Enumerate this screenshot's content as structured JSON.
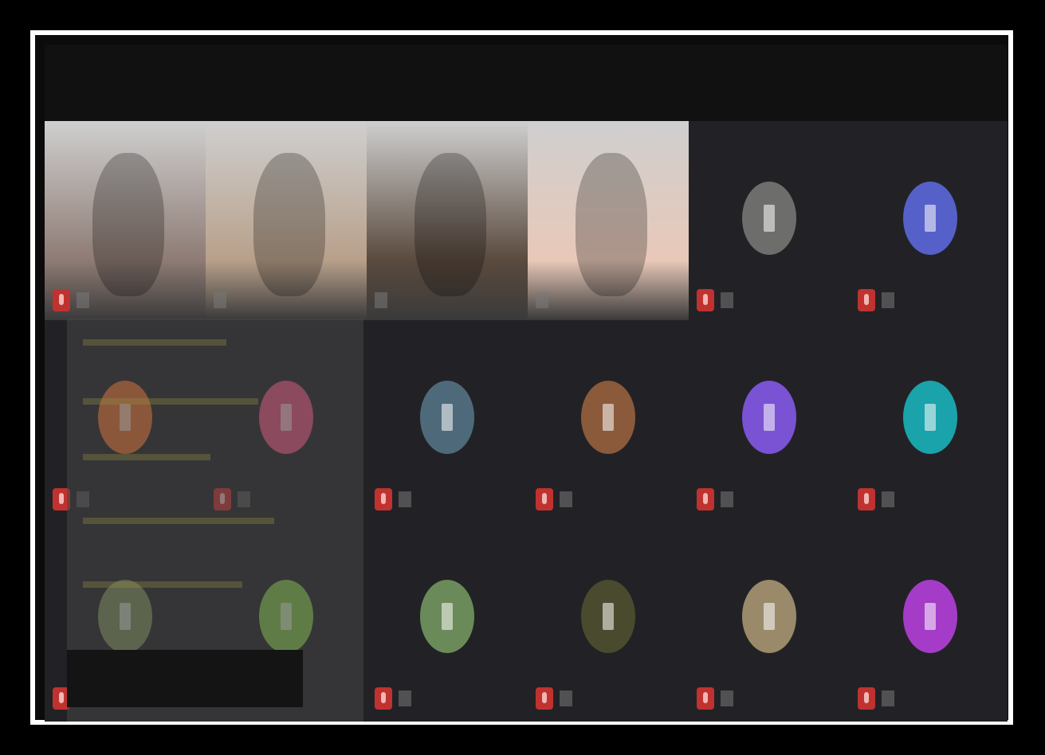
{
  "meeting": {
    "top_bar_title": "",
    "participants": [
      {
        "name": "",
        "type": "video",
        "muted": true,
        "tone": "#8e7b74"
      },
      {
        "name": "",
        "type": "video",
        "muted": false,
        "tone": "#b8a08a"
      },
      {
        "name": "",
        "type": "video",
        "muted": false,
        "tone": "#5a4a3e"
      },
      {
        "name": "",
        "type": "video",
        "muted": false,
        "tone": "#e8c8b8",
        "active_speaker": true
      },
      {
        "name": "",
        "type": "avatar",
        "muted": true,
        "avatar_color": "#6d6d6b",
        "avatar_kind": "photo-icon"
      },
      {
        "name": "",
        "type": "avatar",
        "muted": true,
        "avatar_color": "#5560c8",
        "avatar_kind": "letter-icon"
      },
      {
        "name": "",
        "type": "avatar",
        "muted": true,
        "avatar_color": "#e06e2f",
        "avatar_kind": "letter-icon"
      },
      {
        "name": "",
        "type": "avatar",
        "muted": true,
        "avatar_color": "#e0507a",
        "avatar_kind": "letter-icon"
      },
      {
        "name": "",
        "type": "avatar",
        "muted": true,
        "avatar_color": "#4e6a7a",
        "avatar_kind": "letter-icon"
      },
      {
        "name": "",
        "type": "avatar",
        "muted": true,
        "avatar_color": "#8a5a3a",
        "avatar_kind": "photo-icon"
      },
      {
        "name": "",
        "type": "avatar",
        "muted": true,
        "avatar_color": "#7a52d4",
        "avatar_kind": "letter-icon"
      },
      {
        "name": "",
        "type": "avatar",
        "muted": true,
        "avatar_color": "#1aa3aa",
        "avatar_kind": "letter-icon"
      },
      {
        "name": "",
        "type": "avatar",
        "muted": true,
        "avatar_color": "#7a8a5a",
        "avatar_kind": "photo-icon"
      },
      {
        "name": "",
        "type": "avatar",
        "muted": false,
        "avatar_color": "#7fbf4a",
        "avatar_kind": "letter-icon"
      },
      {
        "name": "",
        "type": "avatar",
        "muted": true,
        "avatar_color": "#6a8a5a",
        "avatar_kind": "photo-icon"
      },
      {
        "name": "",
        "type": "avatar",
        "muted": true,
        "avatar_color": "#4a4a2e",
        "avatar_kind": "photo-icon"
      },
      {
        "name": "",
        "type": "avatar",
        "muted": true,
        "avatar_color": "#9a8a6a",
        "avatar_kind": "photo-icon"
      },
      {
        "name": "",
        "type": "avatar",
        "muted": true,
        "avatar_color": "#a53cc8",
        "avatar_kind": "letter-icon"
      }
    ]
  },
  "toast": {
    "text": ""
  },
  "colors": {
    "active_speaker": "#2fb08a",
    "muted_indicator": "#c0322f",
    "grid_bg": "#212124"
  }
}
